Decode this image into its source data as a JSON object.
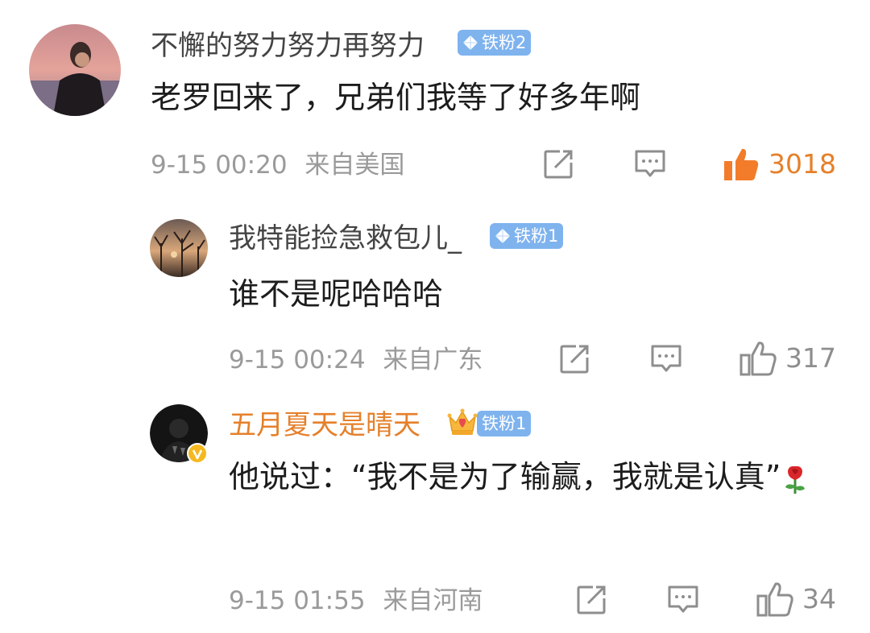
{
  "comments": [
    {
      "username": "不懈的努力努力再努力",
      "badge": "铁粉2",
      "text": "老罗回来了，兄弟们我等了好多年啊",
      "time": "9-15 00:20",
      "location": "来自美国",
      "likes": "3018",
      "liked": true
    },
    {
      "username": "我特能捡急救包儿_",
      "badge": "铁粉1",
      "text": "谁不是呢哈哈哈",
      "time": "9-15 00:24",
      "location": "来自广东",
      "likes": "317",
      "liked": false
    },
    {
      "username": "五月夏天是晴天",
      "badge": "铁粉1",
      "text": "他说过：“我不是为了输赢，我就是认真”",
      "time": "9-15 01:55",
      "location": "来自河南",
      "likes": "34",
      "liked": false,
      "verified": true,
      "emoji": "rose"
    }
  ],
  "colors": {
    "accent_orange": "#e5802b",
    "badge_blue": "#7fb3ee",
    "meta_gray": "#9a9a9a"
  },
  "icons": [
    "share-icon",
    "comment-icon",
    "thumbs-up-icon",
    "diamond-icon",
    "crown-icon",
    "rose-emoji",
    "verified-icon"
  ]
}
